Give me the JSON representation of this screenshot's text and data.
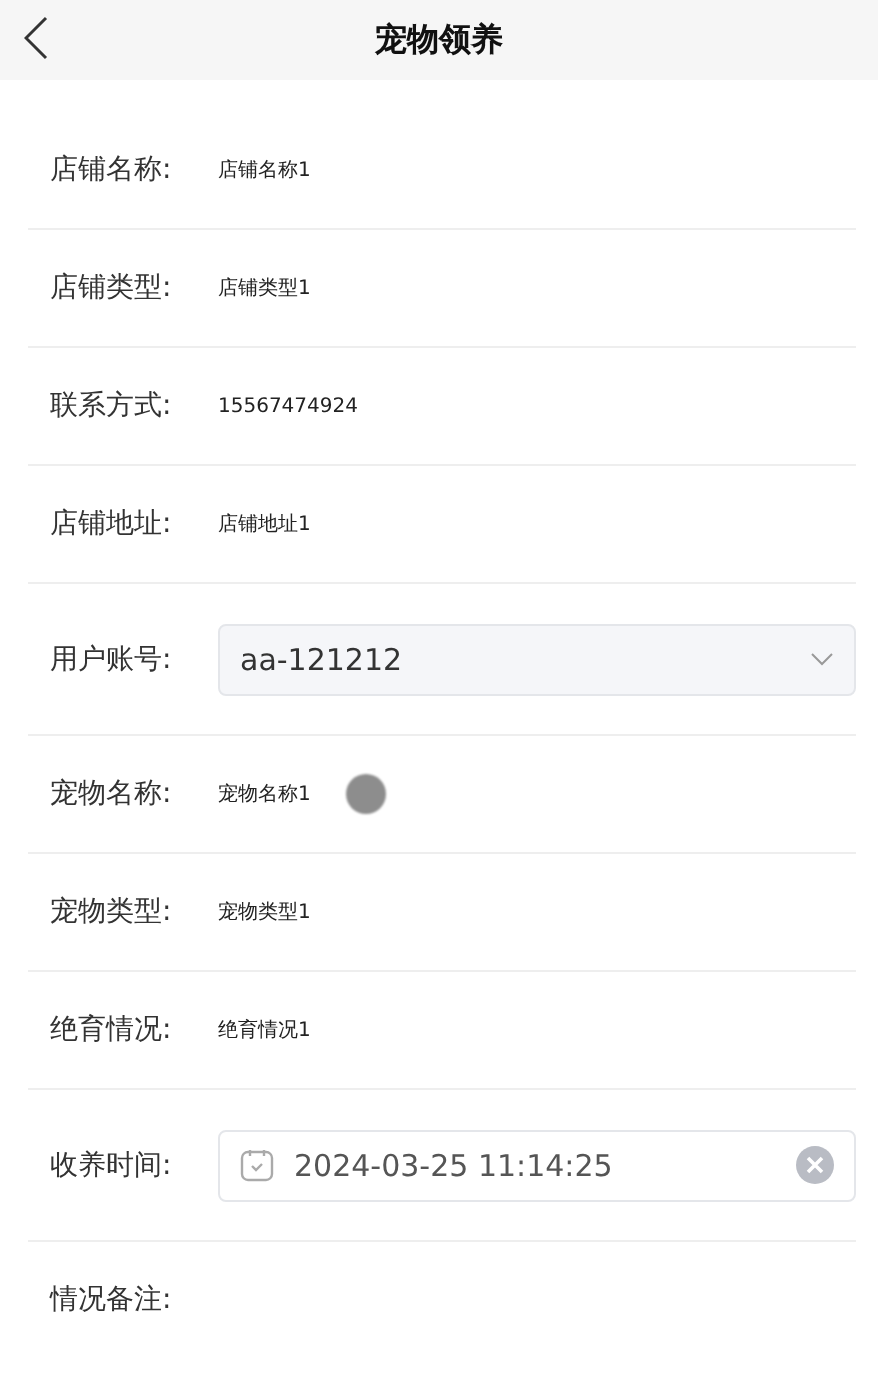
{
  "header": {
    "title": "宠物领养"
  },
  "fields": [
    {
      "kind": "text",
      "label": "店铺名称:",
      "value": "店铺名称1"
    },
    {
      "kind": "text",
      "label": "店铺类型:",
      "value": "店铺类型1"
    },
    {
      "kind": "text",
      "label": "联系方式:",
      "value": "15567474924"
    },
    {
      "kind": "text",
      "label": "店铺地址:",
      "value": "店铺地址1"
    },
    {
      "kind": "select",
      "label": "用户账号:",
      "value": "aa-121212"
    },
    {
      "kind": "text",
      "label": "宠物名称:",
      "value": "宠物名称1",
      "touch": true
    },
    {
      "kind": "text",
      "label": "宠物类型:",
      "value": "宠物类型1"
    },
    {
      "kind": "text",
      "label": "绝育情况:",
      "value": "绝育情况1"
    },
    {
      "kind": "date",
      "label": "收养时间:",
      "value": "2024-03-25 11:14:25"
    },
    {
      "kind": "textarea",
      "label": "情况备注:"
    }
  ]
}
